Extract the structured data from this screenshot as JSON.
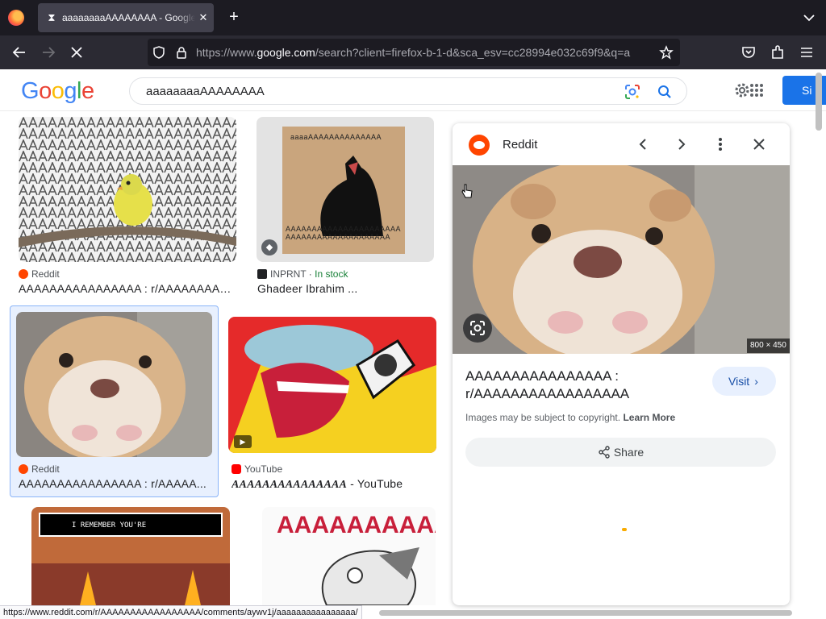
{
  "browser": {
    "tab_title": "aaaaaaaaAAAAAAAA - Google Search",
    "url_prefix": "https://www.",
    "url_domain": "google.com",
    "url_rest": "/search?client=firefox-b-1-d&sca_esv=cc28994e032c69f9&q=a",
    "status_url": "https://www.reddit.com/r/AAAAAAAAAAAAAAAAA/comments/aywv1j/aaaaaaaaaaaaaaaa/"
  },
  "google": {
    "logo": [
      "G",
      "o",
      "o",
      "g",
      "l",
      "e"
    ],
    "logo_colors": [
      "#4285f4",
      "#ea4335",
      "#fbbc05",
      "#4285f4",
      "#34a853",
      "#ea4335"
    ],
    "query": "aaaaaaaaAAAAAAAA",
    "signin_label": "Si"
  },
  "results": [
    {
      "source": "Reddit",
      "title": "AAAAAAAAAAAAAAAA : r/AAAAAAAAA...",
      "fav_color": "#ff4500"
    },
    {
      "source": "INPRNT",
      "stock": "In stock",
      "title": "Ghadeer Ibrahim ...",
      "fav_color": "#202124"
    },
    {
      "source": "Reddit",
      "title": "AAAAAAAAAAAAAAAA : r/AAAAA...",
      "fav_color": "#ff4500"
    },
    {
      "source": "YouTube",
      "title_italic": "AAAAAAAAAAAAAAA",
      "title_suffix": " - YouTube",
      "fav_color": "#ff0000"
    },
    {
      "thumb_text": "I REMEMBER YOU'RE"
    },
    {
      "thumb_text": "AAAAAAAAAA"
    }
  ],
  "cat_image_text_top": "aaaaAAAAAAAAAAAAAA",
  "cat_image_text_bottom": "AAAAAAAAAAAAAAAAAAAAAAAAAAAAAAAAAAAAAAAAAA",
  "panel": {
    "source": "Reddit",
    "dimensions": "800 × 450",
    "title": "AAAAAAAAAAAAAAAA : r/AAAAAAAAAAAAAAAAA",
    "visit_label": "Visit",
    "copyright": "Images may be subject to copyright.",
    "learn_more": "Learn More",
    "share_label": "Share"
  },
  "colors": {
    "accent": "#1a73e8",
    "chrome_dark": "#1c1b22",
    "chrome": "#2b2a33"
  }
}
